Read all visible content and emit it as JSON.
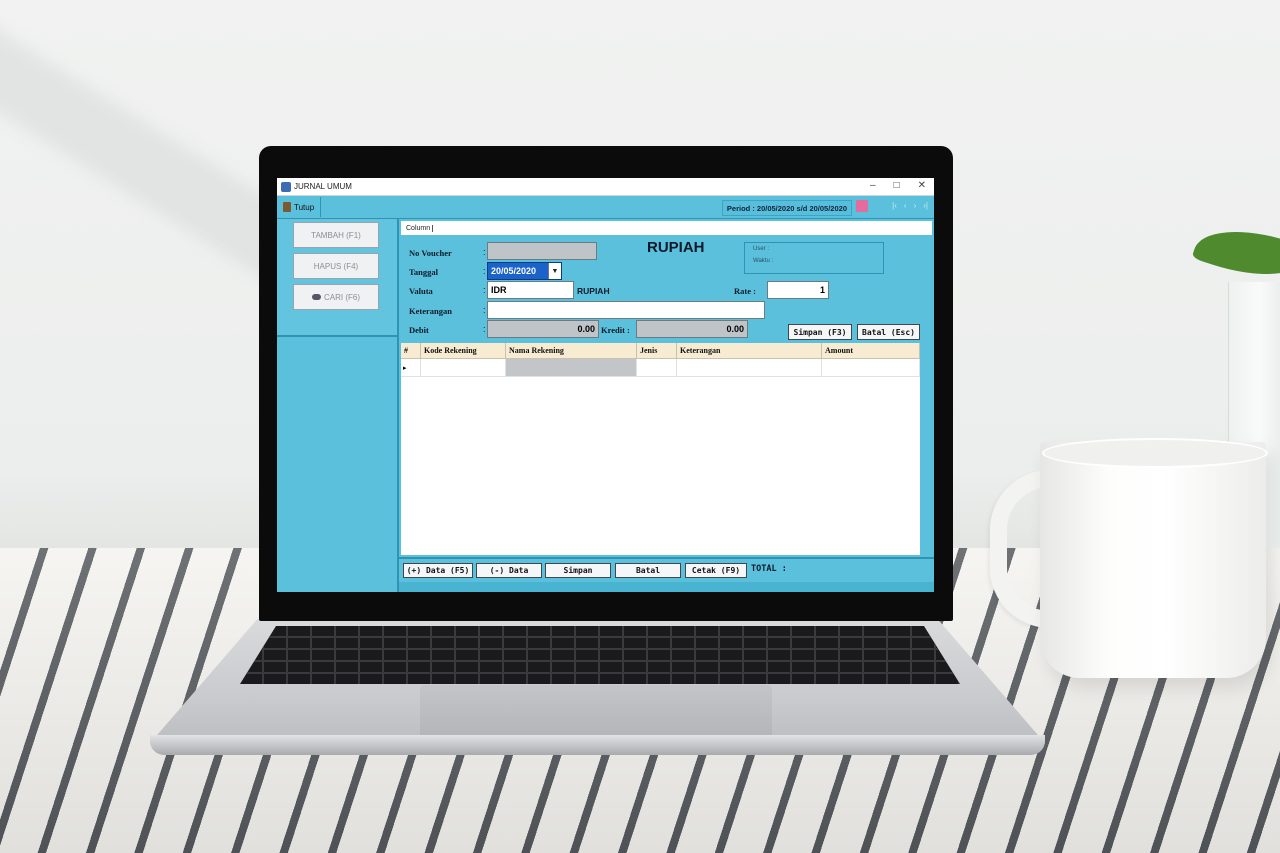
{
  "window": {
    "title": "JURNAL UMUM",
    "controls": {
      "minimize": "–",
      "maximize": "□",
      "close": "✕"
    }
  },
  "toolbar": {
    "close_label": "Tutup",
    "period": "Period : 20/05/2020 s/d 20/05/2020",
    "nav": [
      "|‹",
      "‹",
      "›",
      "›|"
    ]
  },
  "sidebar": {
    "buttons": [
      {
        "label": "TAMBAH (F1)"
      },
      {
        "label": "HAPUS (F4)"
      },
      {
        "label": "CARI (F6)"
      }
    ]
  },
  "main": {
    "column_tab": "Column",
    "currency_title": "RUPIAH",
    "info": {
      "user_label": "User :",
      "time_label": "Waktu :"
    },
    "form": {
      "voucher_label": "No Voucher",
      "voucher_value": "",
      "date_label": "Tanggal",
      "date_value": "20/05/2020",
      "currency_label": "Valuta",
      "currency_code": "IDR",
      "currency_name": "RUPIAH",
      "rate_label": "Rate :",
      "rate_value": "1",
      "note_label": "Keterangan",
      "note_value": "",
      "debit_label": "Debit",
      "debit_value": "0.00",
      "credit_label": "Kredit :",
      "credit_value": "0.00",
      "colon": ":"
    },
    "actions": {
      "save": "Simpan (F3)",
      "cancel": "Batal (Esc)"
    },
    "grid": {
      "columns": [
        "#",
        "Kode Rekening",
        "Nama Rekening",
        "Jenis",
        "Keterangan",
        "Amount"
      ],
      "row_indicator": "▸"
    },
    "bottom": {
      "add_row": "(+) Data (F5)",
      "remove_row": "(-) Data",
      "save": "Simpan",
      "cancel": "Batal",
      "print": "Cetak (F9)",
      "total_label": "TOTAL :"
    }
  }
}
